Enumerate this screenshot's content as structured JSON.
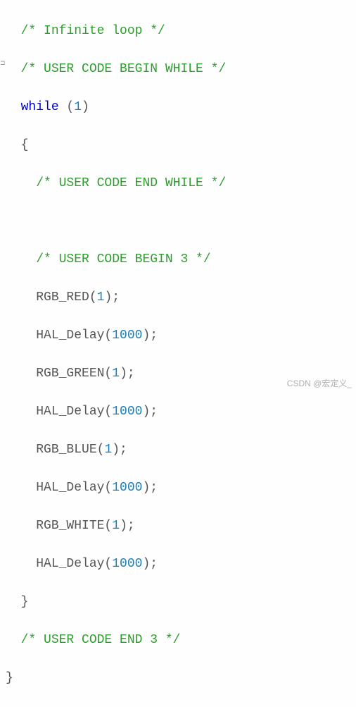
{
  "code": {
    "l1_comment": "/* Infinite loop */",
    "l2_comment": "/* USER CODE BEGIN WHILE */",
    "l3_kw": "while",
    "l3_open": " (",
    "l3_num": "1",
    "l3_close": ")",
    "l4_brace": "{",
    "l5_comment": "/* USER CODE END WHILE */",
    "l7_comment": "/* USER CODE BEGIN 3 */",
    "l8_fn": "RGB_RED(",
    "l8_num": "1",
    "l8_end": ");",
    "l9_fn": "HAL_Delay(",
    "l9_num": "1000",
    "l9_end": ");",
    "l10_fn": "RGB_GREEN(",
    "l10_num": "1",
    "l10_end": ");",
    "l11_fn": "HAL_Delay(",
    "l11_num": "1000",
    "l11_end": ");",
    "l12_fn": "RGB_BLUE(",
    "l12_num": "1",
    "l12_end": ");",
    "l13_fn": "HAL_Delay(",
    "l13_num": "1000",
    "l13_end": ");",
    "l14_fn": "RGB_WHITE(",
    "l14_num": "1",
    "l14_end": ");",
    "l15_fn": "HAL_Delay(",
    "l15_num": "1000",
    "l15_end": ");",
    "l16_brace": "}",
    "l17_comment": "/* USER CODE END 3 */",
    "l18_brace": "}"
  },
  "watermark": "CSDN @宏定义_"
}
